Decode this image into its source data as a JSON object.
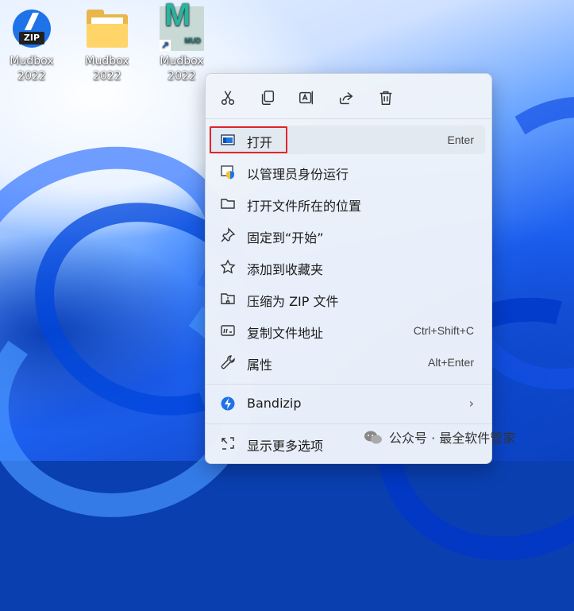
{
  "desktop": {
    "icons": [
      {
        "label_line1": "Mudbox",
        "label_line2": "2022",
        "icon": "zip-archive-icon",
        "badge": "ZIP"
      },
      {
        "label_line1": "Mudbox",
        "label_line2": "2022",
        "icon": "folder-icon"
      },
      {
        "label_line1": "Mudbox",
        "label_line2": "2022",
        "icon": "mudbox-app-icon",
        "badge": "MUD"
      }
    ]
  },
  "context_menu": {
    "quick_actions": [
      {
        "name": "cut",
        "icon": "scissors-icon"
      },
      {
        "name": "copy",
        "icon": "copy-icon"
      },
      {
        "name": "rename",
        "icon": "rename-icon"
      },
      {
        "name": "share",
        "icon": "share-icon"
      },
      {
        "name": "delete",
        "icon": "trash-icon"
      }
    ],
    "items": [
      {
        "label": "打开",
        "shortcut": "Enter",
        "icon": "open-window-icon",
        "highlighted": true
      },
      {
        "label": "以管理员身份运行",
        "shortcut": "",
        "icon": "shield-icon"
      },
      {
        "label": "打开文件所在的位置",
        "shortcut": "",
        "icon": "folder-icon"
      },
      {
        "label": "固定到“开始”",
        "shortcut": "",
        "icon": "pin-icon"
      },
      {
        "label": "添加到收藏夹",
        "shortcut": "",
        "icon": "star-icon"
      },
      {
        "label": "压缩为 ZIP 文件",
        "shortcut": "",
        "icon": "zip-folder-icon"
      },
      {
        "label": "复制文件地址",
        "shortcut": "Ctrl+Shift+C",
        "icon": "copy-path-icon"
      },
      {
        "label": "属性",
        "shortcut": "Alt+Enter",
        "icon": "wrench-icon"
      },
      {
        "label": "Bandizip",
        "shortcut": "",
        "icon": "bandizip-icon",
        "submenu": true
      },
      {
        "label": "显示更多选项",
        "shortcut": "",
        "icon": "more-options-icon"
      }
    ],
    "colors": {
      "highlight_border": "#e0262b",
      "accent": "#1e73e8"
    }
  },
  "watermark": {
    "text": "公众号 · 最全软件管家"
  }
}
